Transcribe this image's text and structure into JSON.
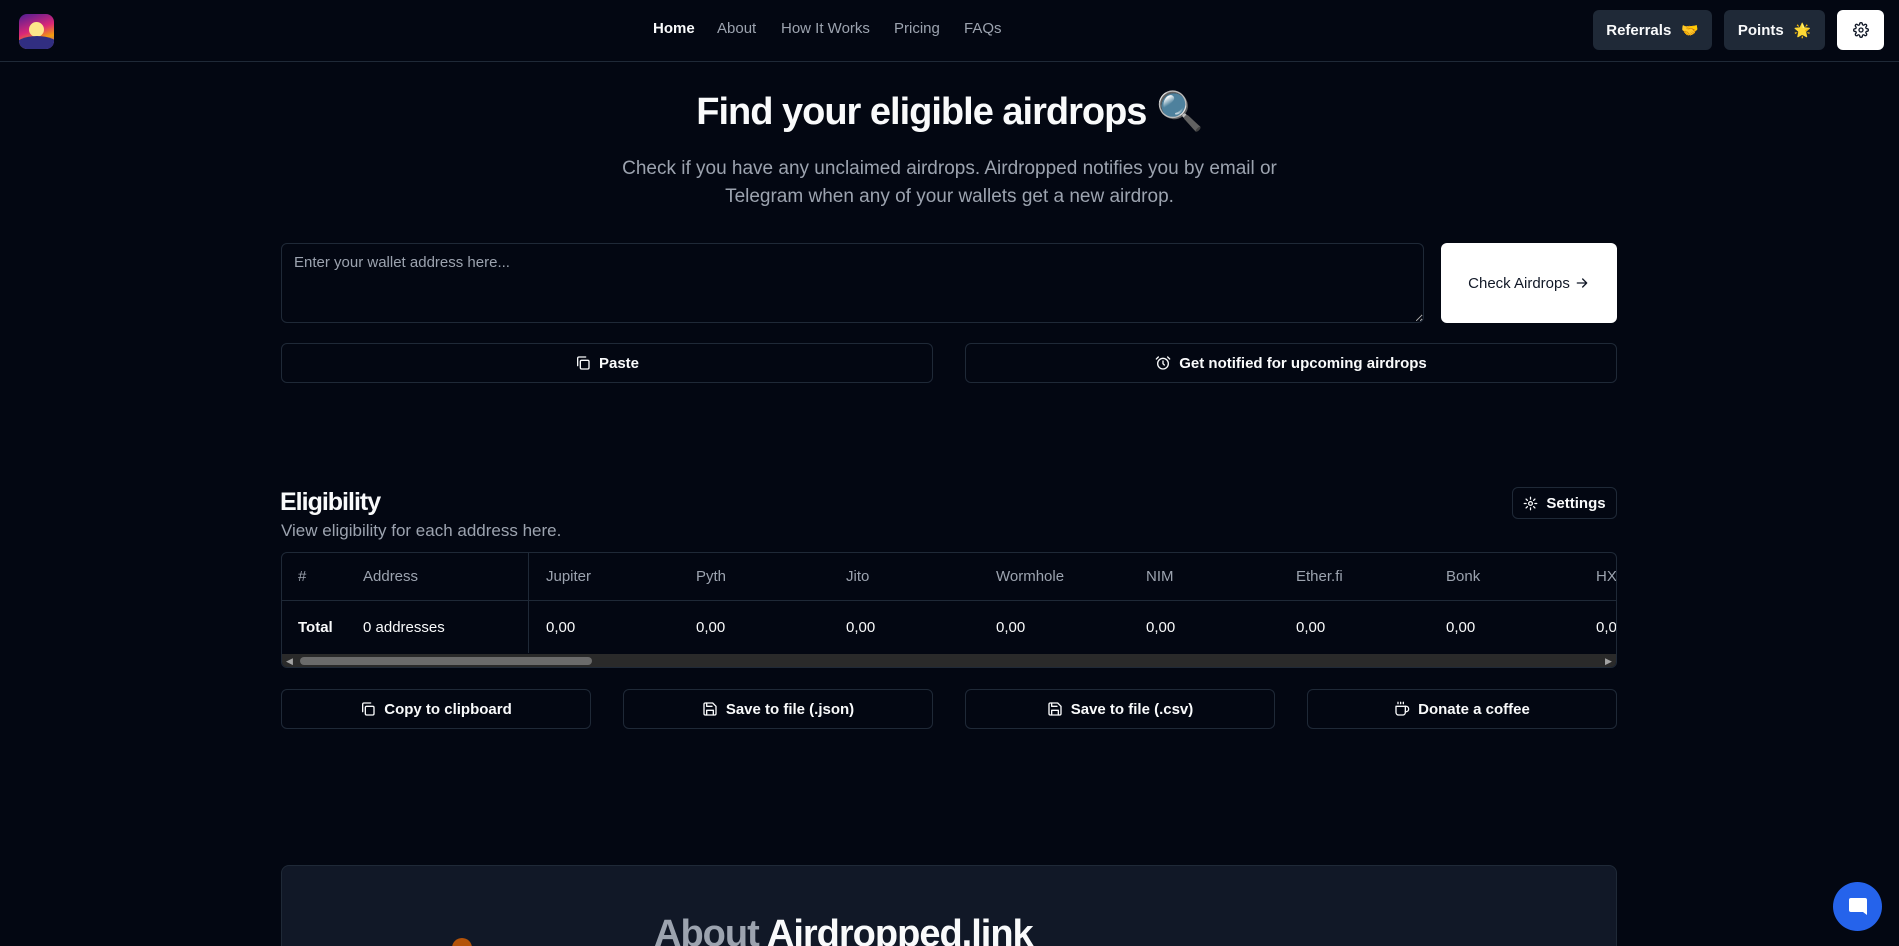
{
  "nav": {
    "items": [
      {
        "label": "Home",
        "active": true
      },
      {
        "label": "About",
        "active": false
      },
      {
        "label": "How It Works",
        "active": false
      },
      {
        "label": "Pricing",
        "active": false
      },
      {
        "label": "FAQs",
        "active": false
      }
    ],
    "referrals": {
      "label": "Referrals",
      "emoji": "🤝"
    },
    "points": {
      "label": "Points",
      "emoji": "🌟"
    },
    "settings_icon": "gear-icon"
  },
  "hero": {
    "title": "Find your eligible airdrops",
    "title_emoji": "🔍",
    "subtitle": "Check if you have any unclaimed airdrops. Airdropped notifies you by email or Telegram when any of your wallets get a new airdrop.",
    "input_placeholder": "Enter your wallet address here...",
    "check_button": "Check Airdrops",
    "paste_button": "Paste",
    "notify_button": "Get notified for upcoming airdrops"
  },
  "eligibility": {
    "title": "Eligibility",
    "subtitle": "View eligibility for each address here.",
    "settings_button": "Settings",
    "columns": [
      "#",
      "Address",
      "Jupiter",
      "Pyth",
      "Jito",
      "Wormhole",
      "NIM",
      "Ether.fi",
      "Bonk",
      "HX"
    ],
    "total_row": [
      "Total",
      "0 addresses",
      "0,00",
      "0,00",
      "0,00",
      "0,00",
      "0,00",
      "0,00",
      "0,00",
      "0,0"
    ],
    "actions": [
      "Copy to clipboard",
      "Save to file (.json)",
      "Save to file (.csv)",
      "Donate a coffee"
    ]
  },
  "about": {
    "title_prefix": "About",
    "title_brand": "Airdropped.link"
  },
  "colors": {
    "background": "#030712",
    "border": "#1f2937",
    "muted_text": "#9ca3af",
    "chat_button": "#2563eb"
  }
}
